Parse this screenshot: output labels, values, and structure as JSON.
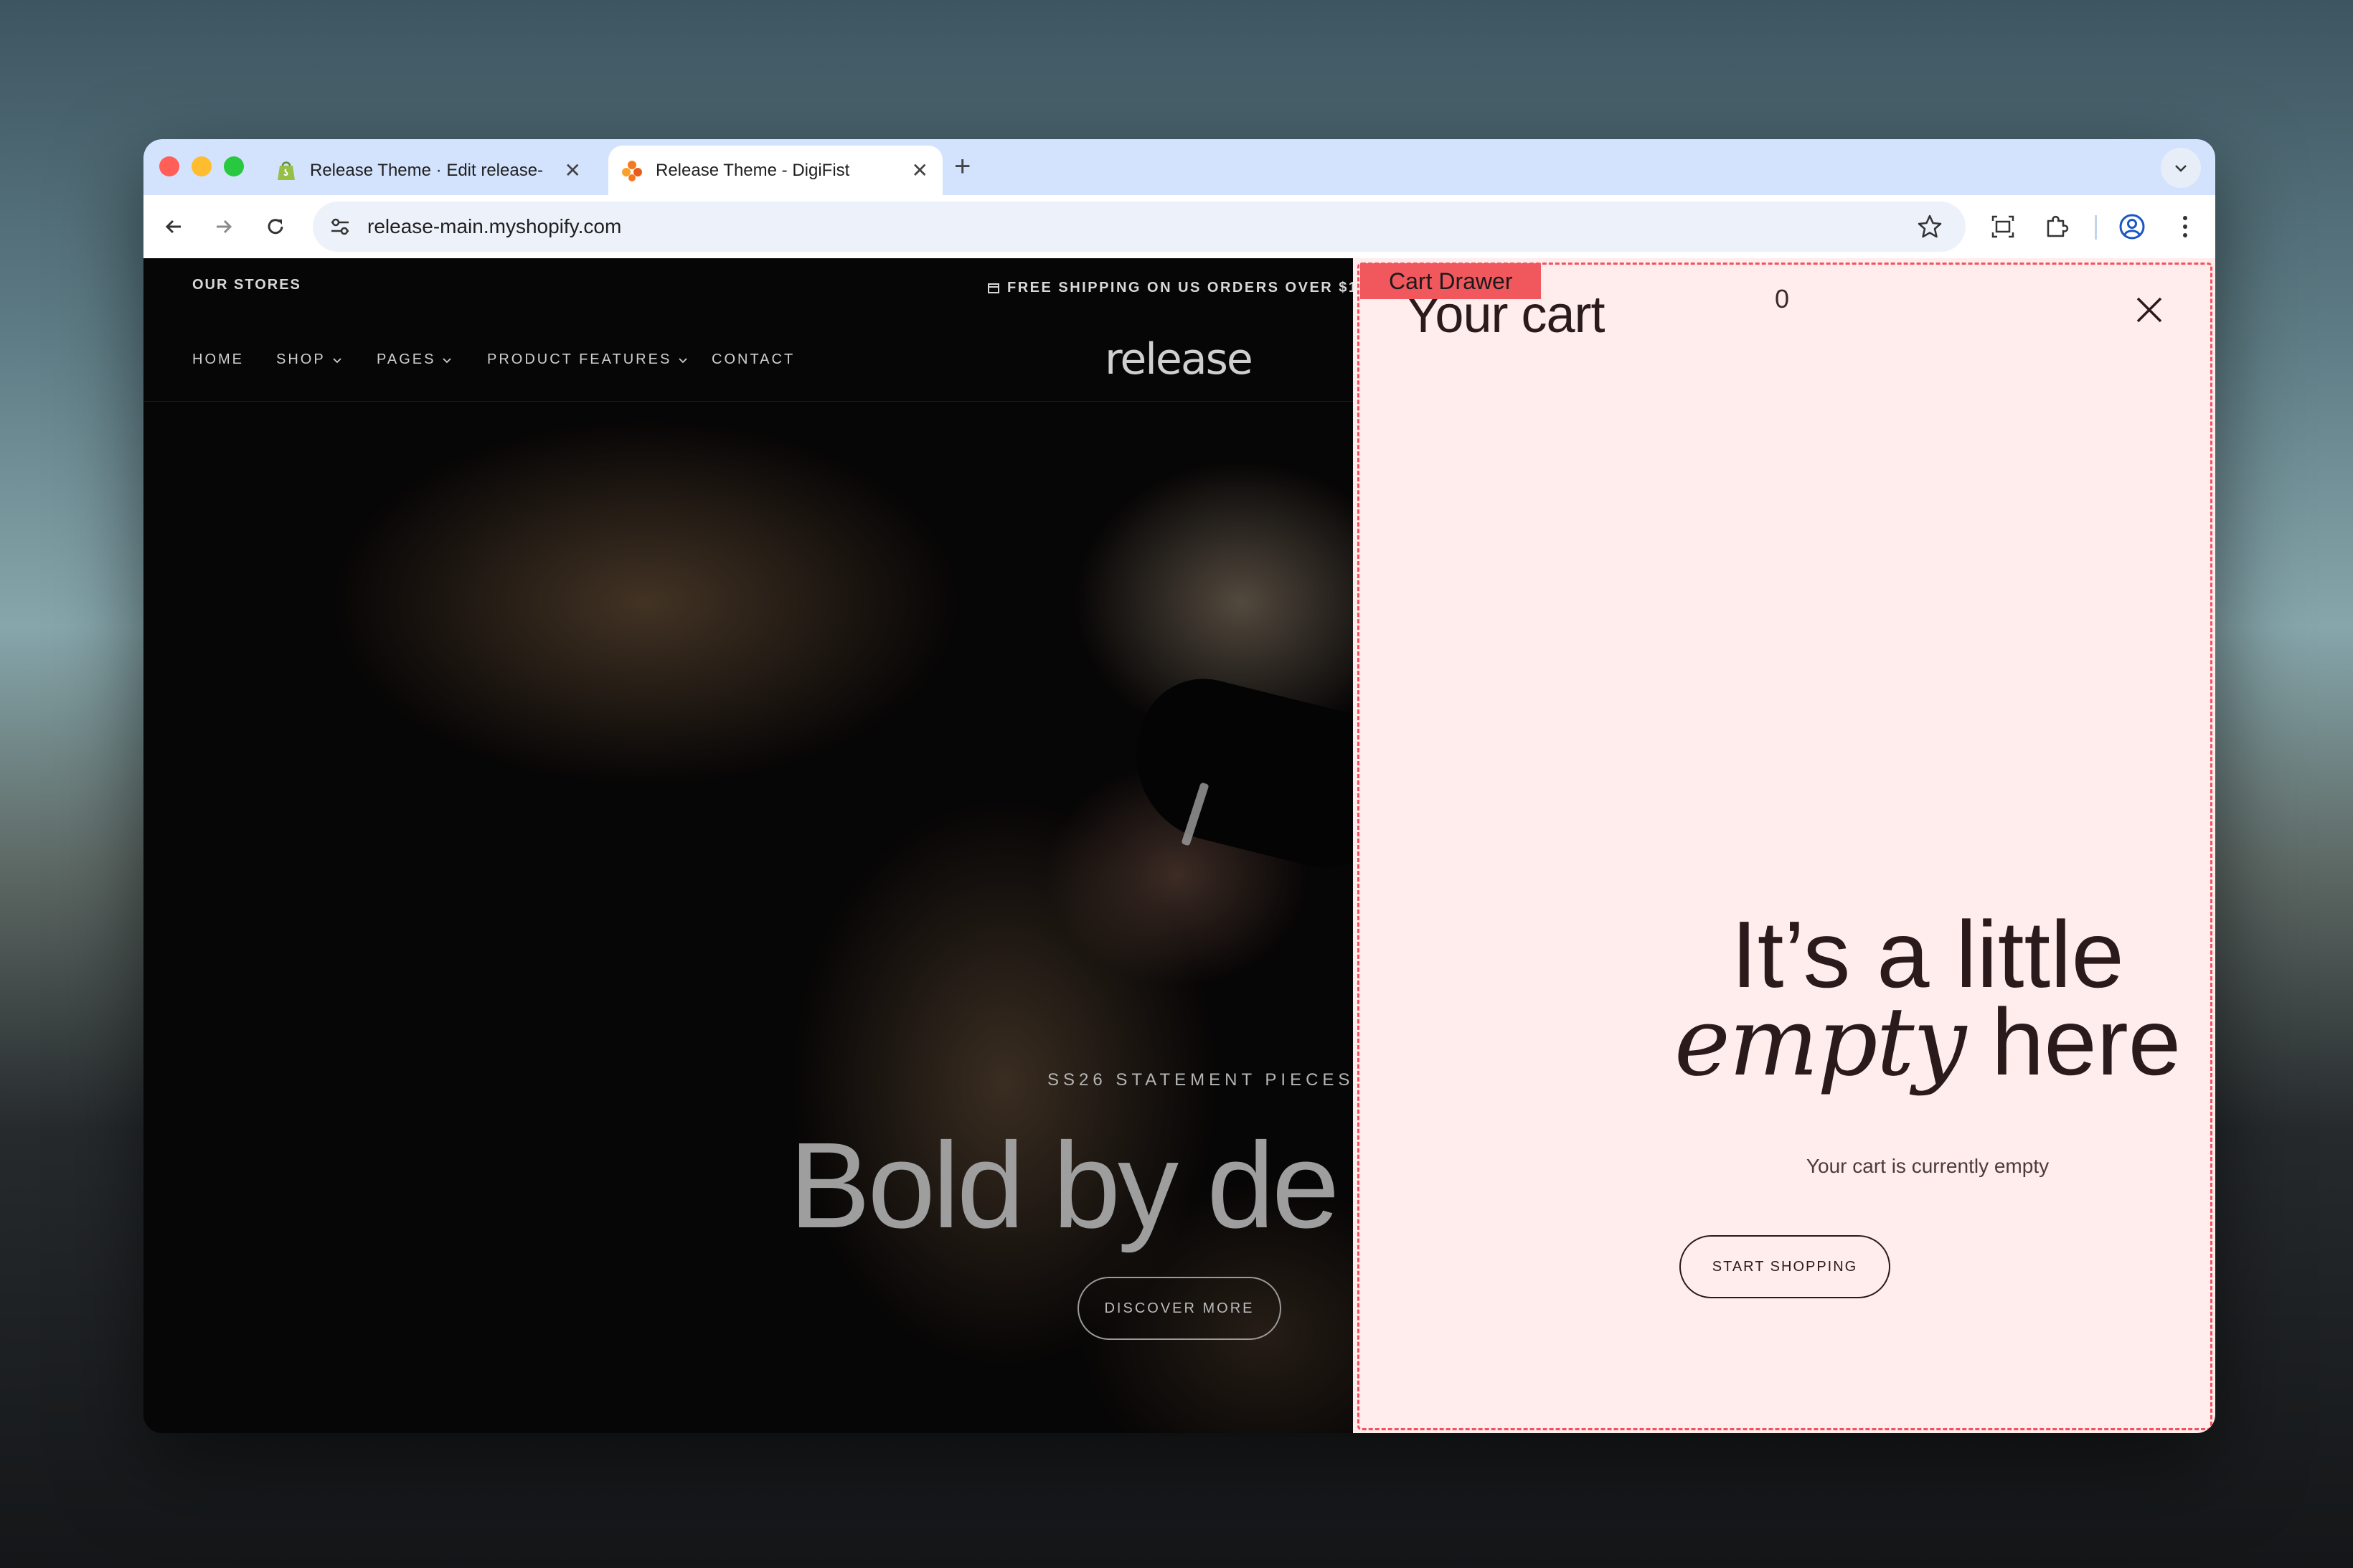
{
  "browser": {
    "tabs": [
      {
        "title": "Release Theme · Edit release-",
        "favicon": "shopify-bag-icon",
        "active": false
      },
      {
        "title": "Release Theme - DigiFist",
        "favicon": "digifist-icon",
        "active": true
      }
    ],
    "new_tab_label": "+",
    "url": "release-main.myshopify.com"
  },
  "store": {
    "announcement_left": "OUR STORES",
    "announcement_right": "FREE SHIPPING ON US ORDERS OVER $1",
    "nav": [
      "HOME",
      "SHOP",
      "PAGES",
      "PRODUCT FEATURES",
      "CONTACT"
    ],
    "logo": "release",
    "hero": {
      "eyebrow": "SS26 STATEMENT PIECES",
      "headline": "Bold by de",
      "cta": "DISCOVER MORE"
    }
  },
  "cart_drawer": {
    "tag_label": "Cart Drawer",
    "title": "Your cart",
    "count": "0",
    "empty_line1": "It’s a little",
    "empty_emphasis": "empty",
    "empty_line2_rest": "here",
    "empty_text": "Your cart is currently empty",
    "cta": "START SHOPPING"
  },
  "colors": {
    "tabstrip": "#d3e3fd",
    "drawer_bg": "#ffeced",
    "drawer_outline": "#f3525d",
    "drawer_tag": "#f0585d",
    "ink": "#2a1a1c"
  }
}
